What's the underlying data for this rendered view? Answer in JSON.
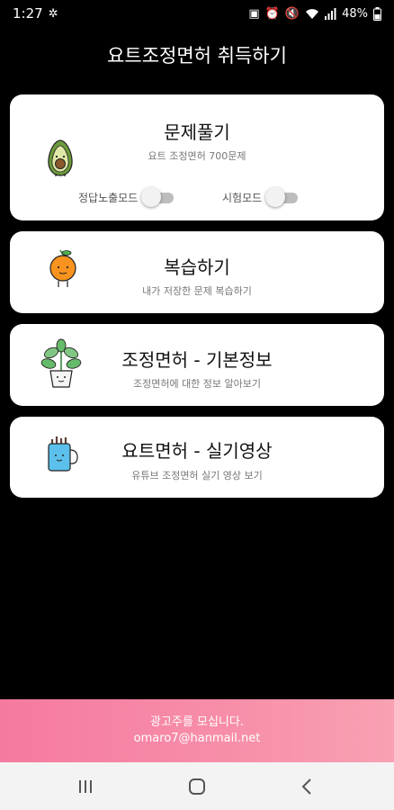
{
  "status_bar": {
    "time": "1:27",
    "battery": "48%"
  },
  "app": {
    "title": "요트조정면허 취득하기"
  },
  "cards": [
    {
      "title": "문제풀기",
      "subtitle": "요트 조정면허 700문제",
      "icon": "avocado-icon",
      "toggles": [
        {
          "label": "정답노출모드",
          "on": false
        },
        {
          "label": "시험모드",
          "on": false
        }
      ]
    },
    {
      "title": "복습하기",
      "subtitle": "내가 저장한 문제 복습하기",
      "icon": "orange-icon"
    },
    {
      "title": "조정면허 - 기본정보",
      "subtitle": "조정면허에 대한 정보 알아보기",
      "icon": "potted-plant-icon"
    },
    {
      "title": "요트면허 - 실기영상",
      "subtitle": "유튜브 조정면허 실기 영상 보기",
      "icon": "mug-icon"
    }
  ],
  "ad_banner": {
    "line1": "광고주를 모십니다.",
    "line2": "omaro7@hanmail.net"
  },
  "colors": {
    "background": "#000000",
    "card": "#ffffff",
    "banner_start": "#f57aa0",
    "banner_end": "#f9a1b3"
  }
}
